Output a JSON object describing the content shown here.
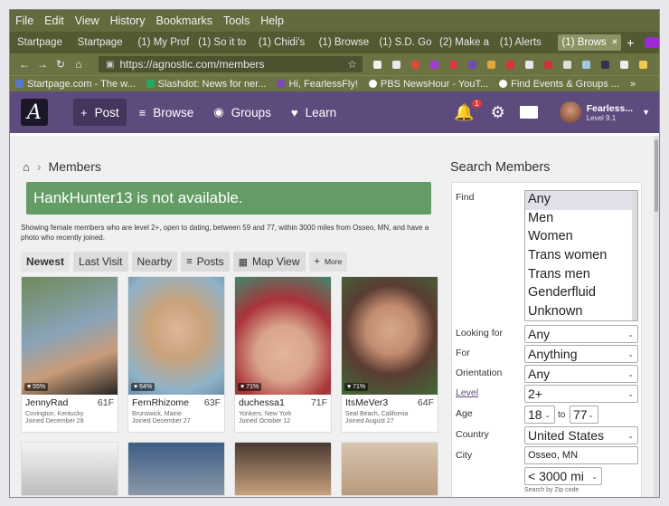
{
  "menu": [
    "File",
    "Edit",
    "View",
    "History",
    "Bookmarks",
    "Tools",
    "Help"
  ],
  "tabs": [
    "Startpage",
    "Startpage",
    "(1) My Prof",
    "(1) So it to",
    "(1) Chidi's",
    "(1) Browse",
    "(1) S.D. Go",
    "(2) Make a",
    "(1) Alerts"
  ],
  "active_tab": "(1) Brows",
  "active_tab_close": "×",
  "tab_plus": "+",
  "nav_icons": [
    "←",
    "→",
    "↻",
    "⌂"
  ],
  "url": "https://agnostic.com/members",
  "bookmarks": [
    "Startpage.com - The w...",
    "Slashdot: News for ner...",
    "Hi, FearlessFly!",
    "PBS NewsHour - YouT...",
    "Find Events & Groups ..."
  ],
  "bookmark_more": "»",
  "site": {
    "logo": "A",
    "nav": [
      "Post",
      "Browse",
      "Groups",
      "Learn"
    ],
    "nav_icons": [
      "+",
      "≡",
      "◉",
      "♥"
    ],
    "badge": "1",
    "user_name": "Fearless...",
    "user_level": "Level 9.1"
  },
  "page": {
    "crumb_home": "⌂",
    "crumb_sep": "›",
    "crumb": "Members",
    "alert": "HankHunter13 is not available.",
    "desc": "Showing female members who are level 2+, open to dating, between 59 and 77, within 3000 miles from Osseo, MN, and have a photo who recently joined."
  },
  "filter_tabs": [
    "Newest",
    "Last Visit",
    "Nearby",
    "Posts",
    "Map View",
    "More"
  ],
  "filter_icons": {
    "posts": "≡",
    "map": "▦",
    "more": "+"
  },
  "cards": [
    {
      "name": "JennyRad",
      "age": "61F",
      "loc": "Covington, Kentucky",
      "joined": "Joined December 28",
      "pct": "♥ 55%",
      "color1": "#6f8a5a",
      "color2": "#c99c7a"
    },
    {
      "name": "FernRhizome",
      "age": "63F",
      "loc": "Brunswick, Maine",
      "joined": "Joined December 27",
      "pct": "♥ 64%",
      "color1": "#c9a27a",
      "color2": "#8fb3c9"
    },
    {
      "name": "duchessa1",
      "age": "71F",
      "loc": "Yonkers, New York",
      "joined": "Joined October 12",
      "pct": "♥ 71%",
      "color1": "#a9323a",
      "color2": "#e3b59a"
    },
    {
      "name": "ItsMeVer3",
      "age": "64F",
      "loc": "Seal Beach, California",
      "joined": "Joined August 27",
      "pct": "♥ 71%",
      "color1": "#3f6a38",
      "color2": "#d7a98b"
    }
  ],
  "row2_colors": [
    "#cfcfcf",
    "#3d5e85",
    "#c7a07a",
    "#b89a7c"
  ],
  "search": {
    "title": "Search Members",
    "find_label": "Find",
    "find_options": [
      "Any",
      "Men",
      "Women",
      "Trans women",
      "Trans men",
      "Genderfluid",
      "Unknown"
    ],
    "looking_label": "Looking for",
    "looking": "Any",
    "for_label": "For",
    "for": "Anything",
    "orient_label": "Orientation",
    "orient": "Any",
    "level_label": "Level",
    "level": "2+",
    "age_label": "Age",
    "age_from": "18",
    "age_to_label": "to",
    "age_to": "77",
    "country_label": "Country",
    "country": "United States",
    "city_label": "City",
    "city": "Osseo, MN",
    "distance": "< 3000 mi",
    "zip_note": "Search by Zip code",
    "dropdown_arrow": "⌄"
  }
}
